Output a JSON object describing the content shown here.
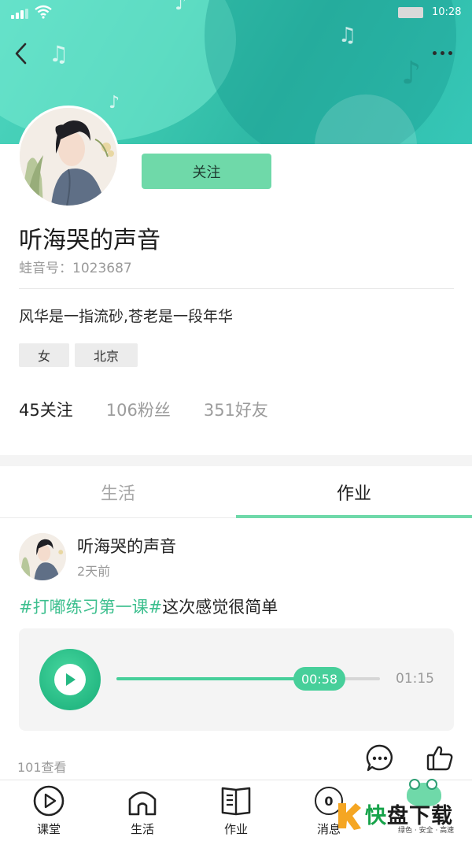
{
  "status_bar": {
    "time": "10:28"
  },
  "colors": {
    "accent": "#6fd9a9",
    "accent_dark": "#25b983",
    "hashtag": "#3cbf8e",
    "banner": "#3cc9b0"
  },
  "header": {
    "back_icon": "chevron-left-icon",
    "more_icon": "more-dots-icon"
  },
  "profile": {
    "follow_label": "关注",
    "name": "听海哭的声音",
    "id_text": "蛙音号：1023687",
    "bio": "风华是一指流砂,苍老是一段年华",
    "tags": [
      "女",
      "北京"
    ],
    "stats": {
      "following": "45关注",
      "fans": "106粉丝",
      "friends": "351好友"
    }
  },
  "tabs": [
    {
      "label": "生活",
      "active": false
    },
    {
      "label": "作业",
      "active": true
    }
  ],
  "post": {
    "author": "听海哭的声音",
    "time": "2天前",
    "hashtag": "#打嘟练习第一课#",
    "text": "这次感觉很简单",
    "audio": {
      "current": "00:58",
      "total": "01:15",
      "progress": 0.77
    },
    "views": "101查看"
  },
  "bottom_nav": [
    {
      "label": "课堂",
      "icon": "play-circle-icon"
    },
    {
      "label": "生活",
      "icon": "home-icon"
    },
    {
      "label": "作业",
      "icon": "book-icon"
    },
    {
      "label": "消息",
      "icon": "message-badge-icon",
      "badge": "0"
    }
  ],
  "watermark": {
    "main_a": "快",
    "main_b": "盘下载",
    "sub": "绿色 · 安全 · 高速"
  }
}
